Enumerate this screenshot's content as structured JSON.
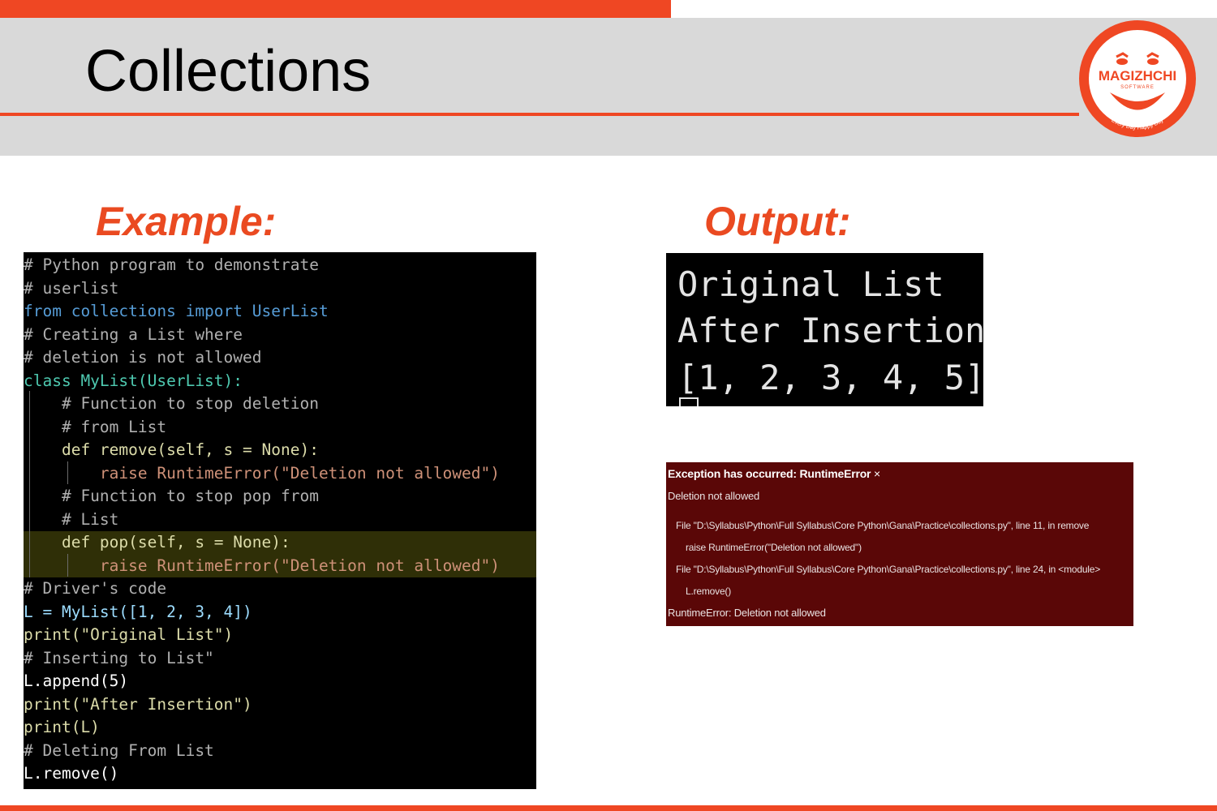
{
  "slide": {
    "title": "Collections",
    "example_label": "Example:",
    "output_label": "Output:"
  },
  "logo": {
    "name": "MAGIZHCHI",
    "sub": "SOFTWARE",
    "tagline": "Every Day Happy Day"
  },
  "code_lines": [
    "# Python program to demonstrate",
    "# userlist",
    "from collections import UserList",
    "# Creating a List where",
    "# deletion is not allowed",
    "class MyList(UserList):",
    "    # Function to stop deletion",
    "    # from List",
    "    def remove(self, s = None):",
    "        raise RuntimeError(\"Deletion not allowed\")",
    "    # Function to stop pop from",
    "    # List",
    "    def pop(self, s = None):",
    "        raise RuntimeError(\"Deletion not allowed\")",
    "# Driver's code",
    "L = MyList([1, 2, 3, 4])",
    "print(\"Original List\")",
    "# Inserting to List\"",
    "L.append(5)",
    "print(\"After Insertion\")",
    "print(L)",
    "# Deleting From List",
    "L.remove()"
  ],
  "output": {
    "lines": [
      "Original List",
      "After Insertion",
      "[1, 2, 3, 4, 5]"
    ]
  },
  "error": {
    "title": "Exception has occurred: RuntimeError",
    "close": "×",
    "message": "Deletion not allowed",
    "trace1_file": "File \"D:\\Syllabus\\Python\\Full Syllabus\\Core Python\\Gana\\Practice\\collections.py\", line 11, in remove",
    "trace1_code": "raise RuntimeError(\"Deletion not allowed\")",
    "trace2_file": "File \"D:\\Syllabus\\Python\\Full Syllabus\\Core Python\\Gana\\Practice\\collections.py\", line 24, in <module>",
    "trace2_code": "L.remove()",
    "final": "RuntimeError: Deletion not allowed"
  },
  "colors": {
    "accent": "#ef4723",
    "header_band": "#d9d9d9",
    "error_bg": "#5a0707"
  }
}
